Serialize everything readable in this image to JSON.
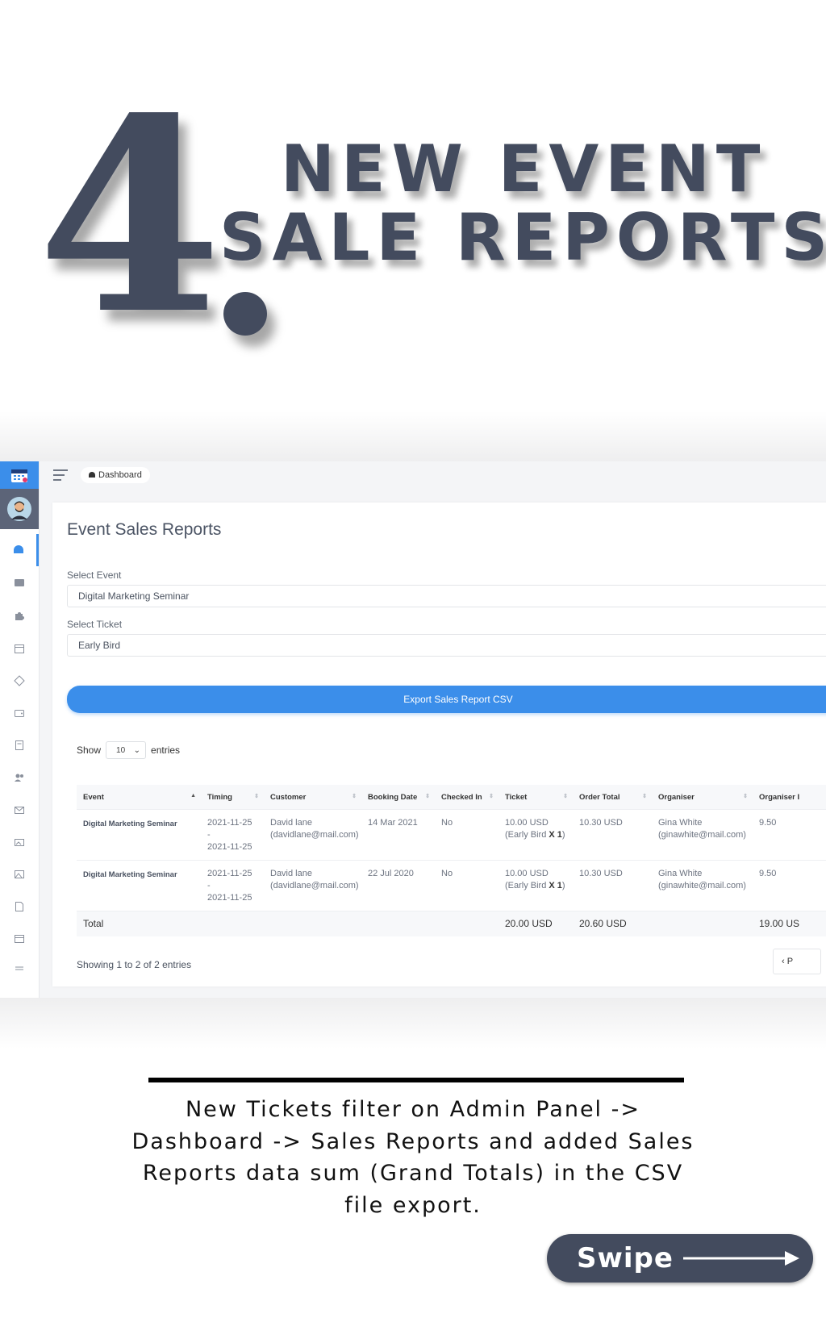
{
  "hero": {
    "number": "4",
    "line1": "NEW EVENT",
    "line2": "SALE REPORTS"
  },
  "topbar": {
    "breadcrumb": "Dashboard"
  },
  "page": {
    "title": "Event Sales Reports",
    "select_event_label": "Select Event",
    "select_event_value": "Digital Marketing Seminar",
    "select_ticket_label": "Select Ticket",
    "select_ticket_value": "Early Bird",
    "export_button": "Export Sales Report CSV",
    "show_label": "Show",
    "entries_value": "10",
    "entries_label": "entries"
  },
  "table": {
    "headers": [
      "Event",
      "Timing",
      "Customer",
      "Booking Date",
      "Checked In",
      "Ticket",
      "Order Total",
      "Organiser",
      "Organiser I"
    ],
    "rows": [
      {
        "event": "Digital Marketing Seminar",
        "timing_1": "2021-11-25 -",
        "timing_2": "2021-11-25",
        "customer_name": "David lane",
        "customer_email": "(davidlane@mail.com)",
        "booking_date": "14 Mar 2021",
        "checked_in": "No",
        "ticket_price": "10.00 USD",
        "ticket_detail_prefix": "(Early Bird ",
        "ticket_detail_qty": "X 1",
        "ticket_detail_suffix": ")",
        "order_total": "10.30 USD",
        "organiser_name": "Gina White",
        "organiser_email": "(ginawhite@mail.com)",
        "organiser_earning": "9.50"
      },
      {
        "event": "Digital Marketing Seminar",
        "timing_1": "2021-11-25 -",
        "timing_2": "2021-11-25",
        "customer_name": "David lane",
        "customer_email": "(davidlane@mail.com)",
        "booking_date": "22 Jul 2020",
        "checked_in": "No",
        "ticket_price": "10.00 USD",
        "ticket_detail_prefix": "(Early Bird ",
        "ticket_detail_qty": "X 1",
        "ticket_detail_suffix": ")",
        "order_total": "10.30 USD",
        "organiser_name": "Gina White",
        "organiser_email": "(ginawhite@mail.com)",
        "organiser_earning": "9.50"
      }
    ],
    "total_label": "Total",
    "total_ticket": "20.00 USD",
    "total_order": "20.60 USD",
    "total_organiser": "19.00 US"
  },
  "footer_table": {
    "showing": "Showing 1 to 2 of 2 entries",
    "pager_label": "P"
  },
  "caption": {
    "text": "New Tickets filter on Admin Panel -> Dashboard -> Sales Reports and added Sales Reports data sum (Grand Totals) in the CSV file export.",
    "swipe": "Swipe"
  },
  "sidebar": {
    "icons": [
      "calendar-logo-icon",
      "user-avatar-icon",
      "dashboard-icon",
      "folder-icon",
      "puzzle-icon",
      "calendar-icon",
      "ticket-icon",
      "wallet-icon",
      "book-icon",
      "users-icon",
      "mail-icon",
      "gallery-icon",
      "image-icon",
      "document-icon",
      "page-icon",
      "list-icon"
    ]
  },
  "colors": {
    "hero": "#434b5e",
    "accent": "#3b8eea",
    "swipe_bg": "#434b5e"
  }
}
